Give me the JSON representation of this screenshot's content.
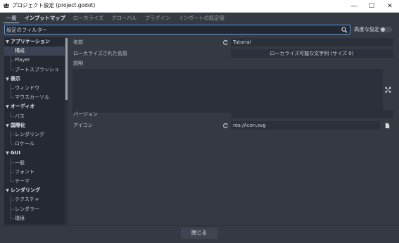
{
  "window": {
    "title": "プロジェクト設定 (project.godot)",
    "controls": {
      "minimize": "—",
      "maximize": "☐",
      "close": "✕"
    }
  },
  "tabs": [
    {
      "label": "一般",
      "state": "active"
    },
    {
      "label": "インプットマップ",
      "state": "bold"
    },
    {
      "label": "ローカライズ",
      "state": "normal"
    },
    {
      "label": "グローバル",
      "state": "normal"
    },
    {
      "label": "プラグイン",
      "state": "normal"
    },
    {
      "label": "インポートの既定値",
      "state": "normal"
    }
  ],
  "search": {
    "placeholder": "設定のフィルター",
    "value": ""
  },
  "advanced": {
    "label": "高度な設定",
    "enabled": false
  },
  "tree": [
    {
      "label": "アプリケーション",
      "type": "section"
    },
    {
      "label": "構成",
      "type": "item",
      "selected": true
    },
    {
      "label": "Player",
      "type": "item"
    },
    {
      "label": "ブートスプラッシュ",
      "type": "item"
    },
    {
      "label": "表示",
      "type": "section"
    },
    {
      "label": "ウィンドウ",
      "type": "item"
    },
    {
      "label": "マウスカーソル",
      "type": "item"
    },
    {
      "label": "オーディオ",
      "type": "section"
    },
    {
      "label": "バス",
      "type": "item"
    },
    {
      "label": "国際化",
      "type": "section"
    },
    {
      "label": "レンダリング",
      "type": "item"
    },
    {
      "label": "ロケール",
      "type": "item"
    },
    {
      "label": "GUI",
      "type": "section"
    },
    {
      "label": "一般",
      "type": "item"
    },
    {
      "label": "フォント",
      "type": "item"
    },
    {
      "label": "テーマ",
      "type": "item"
    },
    {
      "label": "レンダリング",
      "type": "section"
    },
    {
      "label": "テクスチャ",
      "type": "item"
    },
    {
      "label": "レンダラー",
      "type": "item"
    },
    {
      "label": "環境",
      "type": "item"
    }
  ],
  "properties": {
    "name": {
      "label": "名前",
      "value": "Tutorial"
    },
    "localized_name": {
      "label": "ローカライズされた名前",
      "value": "ローカライズ可能な文字列 (サイズ 0)"
    },
    "description": {
      "label": "説明",
      "value": ""
    },
    "version": {
      "label": "バージョン",
      "value": ""
    },
    "icon": {
      "label": "アイコン",
      "value": "res://icon.svg"
    }
  },
  "footer": {
    "close_label": "閉じる"
  },
  "colors": {
    "accent": "#4aa3ff",
    "selection": "#3b4354"
  }
}
